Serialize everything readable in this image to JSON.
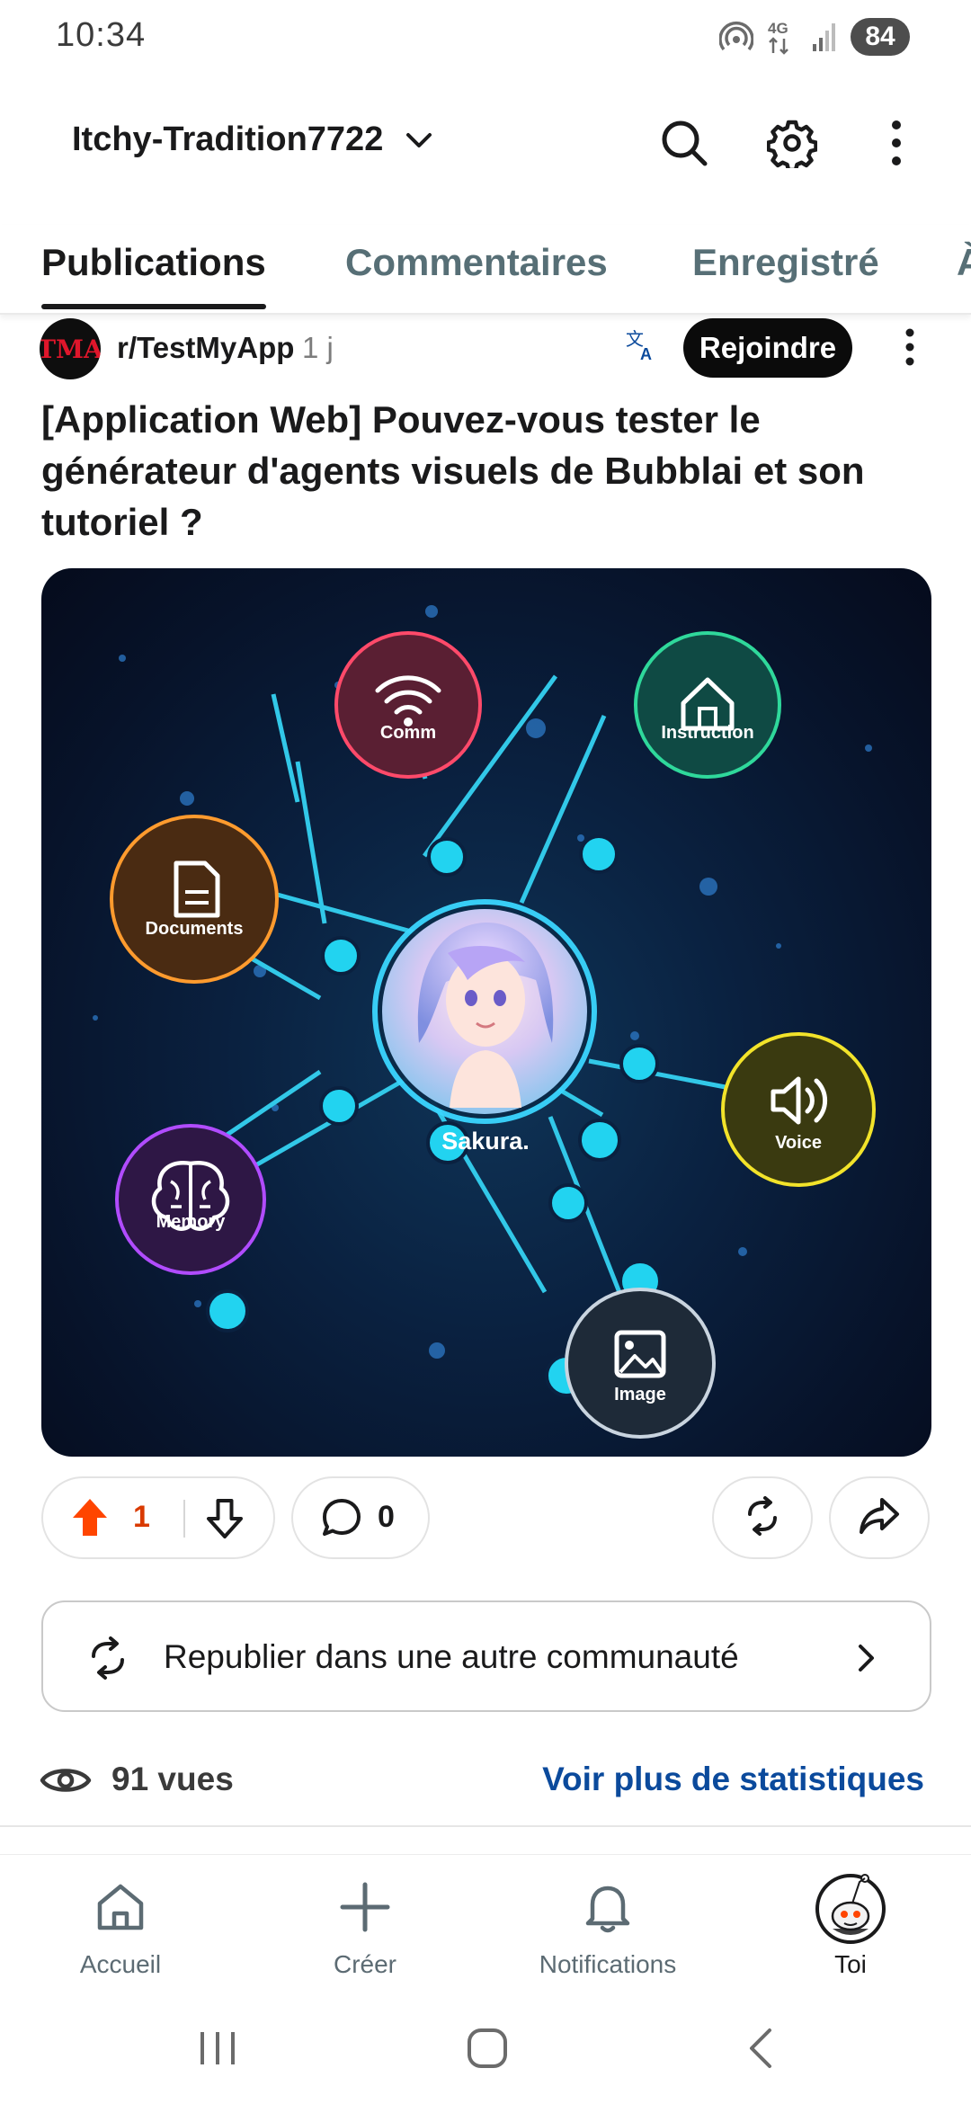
{
  "status_bar": {
    "time": "10:34",
    "battery": "84",
    "network": "4G"
  },
  "header": {
    "username": "Itchy-Tradition7722",
    "icons": [
      "chevron-down-icon",
      "search-icon",
      "settings-gear-icon",
      "more-vertical-icon"
    ]
  },
  "tabs": [
    {
      "label": "Publications",
      "active": true
    },
    {
      "label": "Commentaires",
      "active": false
    },
    {
      "label": "Enregistré",
      "active": false
    },
    {
      "label": "À",
      "active": false
    }
  ],
  "post": {
    "community_avatar_text": "TMA",
    "community": "r/TestMyApp",
    "age": "1 j",
    "join_label": "Rejoindre",
    "title": "[Application Web] Pouvez-vous tester le générateur d'agents visuels de Bubblai et son tutoriel ?",
    "image": {
      "center_label": "Sakura.",
      "nodes": [
        "Comm",
        "Instruction",
        "Documents",
        "Voice",
        "Memory",
        "Image"
      ]
    },
    "votes": "1",
    "comments": "0"
  },
  "republish_label": "Republier dans une autre communauté",
  "views_label": "91 vues",
  "stats_link": "Voir plus de statistiques",
  "bottom_nav": [
    {
      "label": "Accueil",
      "icon": "home-icon"
    },
    {
      "label": "Créer",
      "icon": "plus-icon"
    },
    {
      "label": "Notifications",
      "icon": "bell-icon"
    },
    {
      "label": "Toi",
      "icon": "avatar-icon"
    }
  ],
  "colors": {
    "upvote": "#ff4500",
    "link": "#0b4a9c",
    "join_bg": "#0b0b0b"
  }
}
